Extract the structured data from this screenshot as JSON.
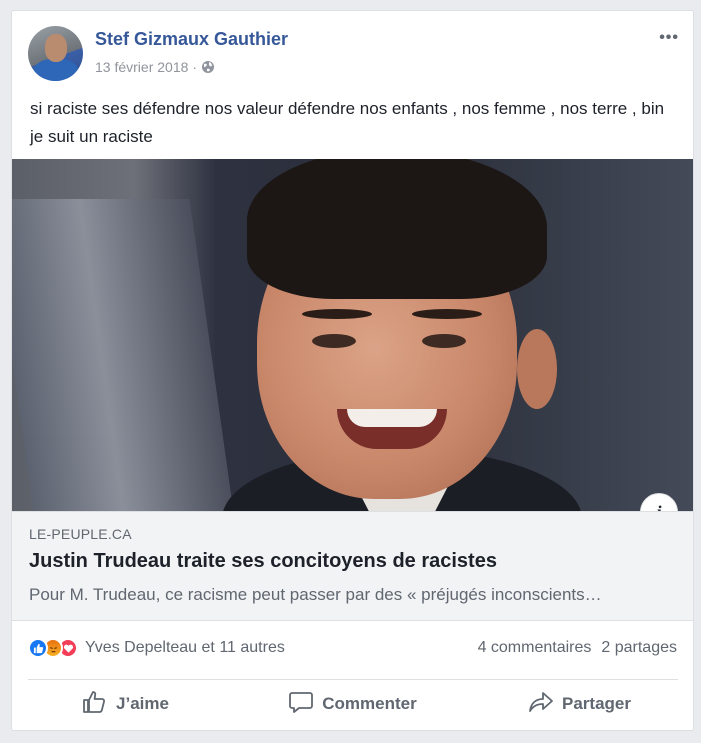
{
  "post": {
    "author": "Stef Gizmaux Gauthier",
    "date": "13 février 2018",
    "date_separator": "·",
    "privacy_icon": "globe-icon",
    "more_label": "•••",
    "text": "si raciste ses défendre nos valeur défendre nos enfants , nos femme , nos terre , bin je suit un raciste"
  },
  "link": {
    "domain": "LE-PEUPLE.CA",
    "title": "Justin Trudeau traite ses concitoyens de racistes",
    "description": "Pour M. Trudeau, ce racisme peut passer par des « préjugés inconscients…",
    "info_label": "i"
  },
  "stats": {
    "reaction_icons": [
      "like-reaction-icon",
      "angry-reaction-icon",
      "love-reaction-icon"
    ],
    "reactors": "Yves Depelteau et 11 autres",
    "comments": "4 commentaires",
    "shares": "2 partages"
  },
  "actions": {
    "like": "J’aime",
    "comment": "Commenter",
    "share": "Partager"
  },
  "colors": {
    "author_link": "#365899",
    "like_blue": "#1877f2",
    "love_red": "#f33e58",
    "muted_text": "#606770"
  }
}
